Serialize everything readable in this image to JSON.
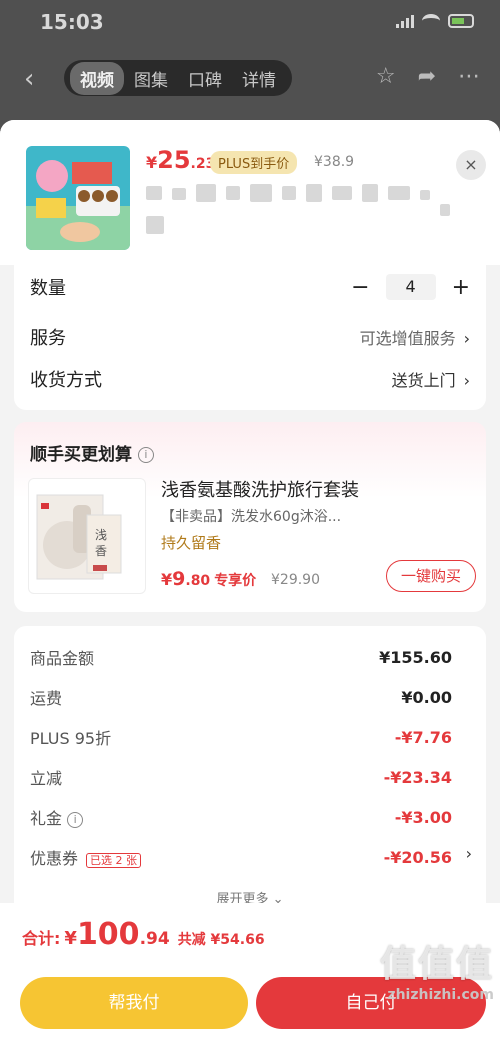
{
  "status_bar": {
    "time": "15:03"
  },
  "nav": {
    "tabs": [
      "视频",
      "图集",
      "口碑",
      "详情"
    ],
    "active_tab": 0,
    "back_icon": "chevron-left-icon"
  },
  "product": {
    "price_symbol": "¥",
    "price_int": "25",
    "price_dec": ".23",
    "plus_badge": "PLUS到手价",
    "orig_price": "¥38.9",
    "close_icon": "×"
  },
  "options": {
    "quantity_label": "数量",
    "minus": "−",
    "quantity": "4",
    "plus": "+",
    "service_label": "服务",
    "service_value": "可选增值服务",
    "delivery_label": "收货方式",
    "delivery_value": "送货上门"
  },
  "addon": {
    "title": "顺手买更划算",
    "info": "i",
    "name": "浅香氨基酸洗护旅行套装",
    "desc": "【非卖品】洗发水60g沐浴...",
    "tag": "持久留香",
    "price_symbol": "¥",
    "price_int": "9",
    "price_dec": ".80",
    "price_label": "专享价",
    "orig_price": "¥29.90",
    "buy_label": "一键购买"
  },
  "summary": {
    "rows": [
      {
        "k": "商品金额",
        "v": "¥155.60"
      },
      {
        "k": "运费",
        "v": "¥0.00"
      },
      {
        "k": "PLUS 95折",
        "v": "-¥7.76"
      },
      {
        "k": "立减",
        "v": "-¥23.34"
      },
      {
        "k": "礼金",
        "v": "-¥3.00"
      },
      {
        "k": "优惠券",
        "v": "-¥20.56",
        "badge": "已选 2 张"
      }
    ],
    "more": "展开更多"
  },
  "footer": {
    "total_label": "合计:",
    "total_symbol": "¥",
    "total_int": "100",
    "total_dec": ".94",
    "saved": "共减 ¥54.66",
    "help_pay": "帮我付",
    "self_pay": "自己付"
  },
  "watermark": {
    "logo": "值值值",
    "url": "zhizhizhi.com"
  },
  "colors": {
    "accent": "#e4393c",
    "yellow": "#f6c533",
    "gold": "#b07a1a"
  }
}
